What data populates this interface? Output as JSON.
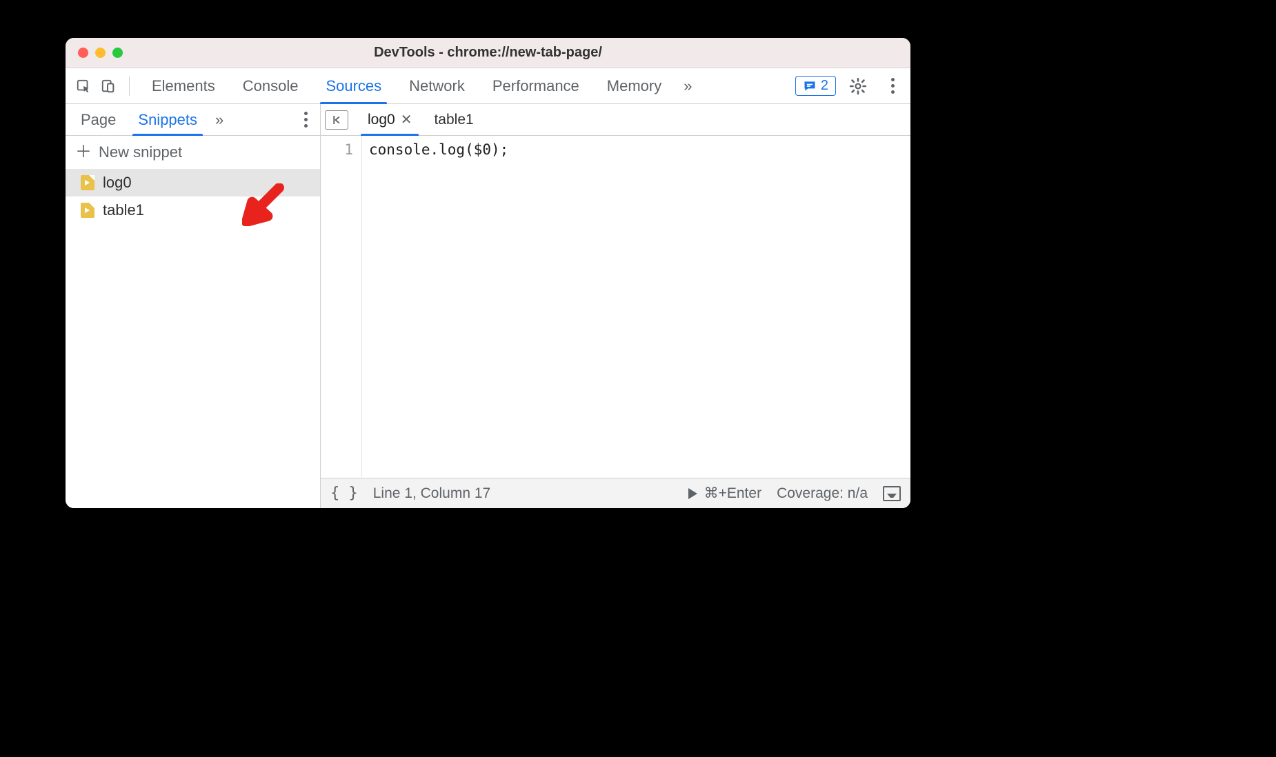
{
  "window": {
    "title": "DevTools - chrome://new-tab-page/"
  },
  "toolbar": {
    "tabs": [
      "Elements",
      "Console",
      "Sources",
      "Network",
      "Performance",
      "Memory"
    ],
    "active_tab_index": 2,
    "overflow_glyph": "»",
    "messages_count": "2"
  },
  "sidebar": {
    "tabs": [
      "Page",
      "Snippets"
    ],
    "active_tab_index": 1,
    "overflow_glyph": "»",
    "new_snippet_label": "New snippet",
    "items": [
      {
        "name": "log0",
        "active": true
      },
      {
        "name": "table1",
        "active": false
      }
    ]
  },
  "editor": {
    "tabs": [
      {
        "name": "log0",
        "active": true,
        "closable": true
      },
      {
        "name": "table1",
        "active": false,
        "closable": false
      }
    ],
    "gutter_line": "1",
    "code_line": "console.log($0);"
  },
  "statusbar": {
    "braces": "{ }",
    "cursor": "Line 1, Column 17",
    "run_hint": "⌘+Enter",
    "coverage": "Coverage: n/a"
  }
}
